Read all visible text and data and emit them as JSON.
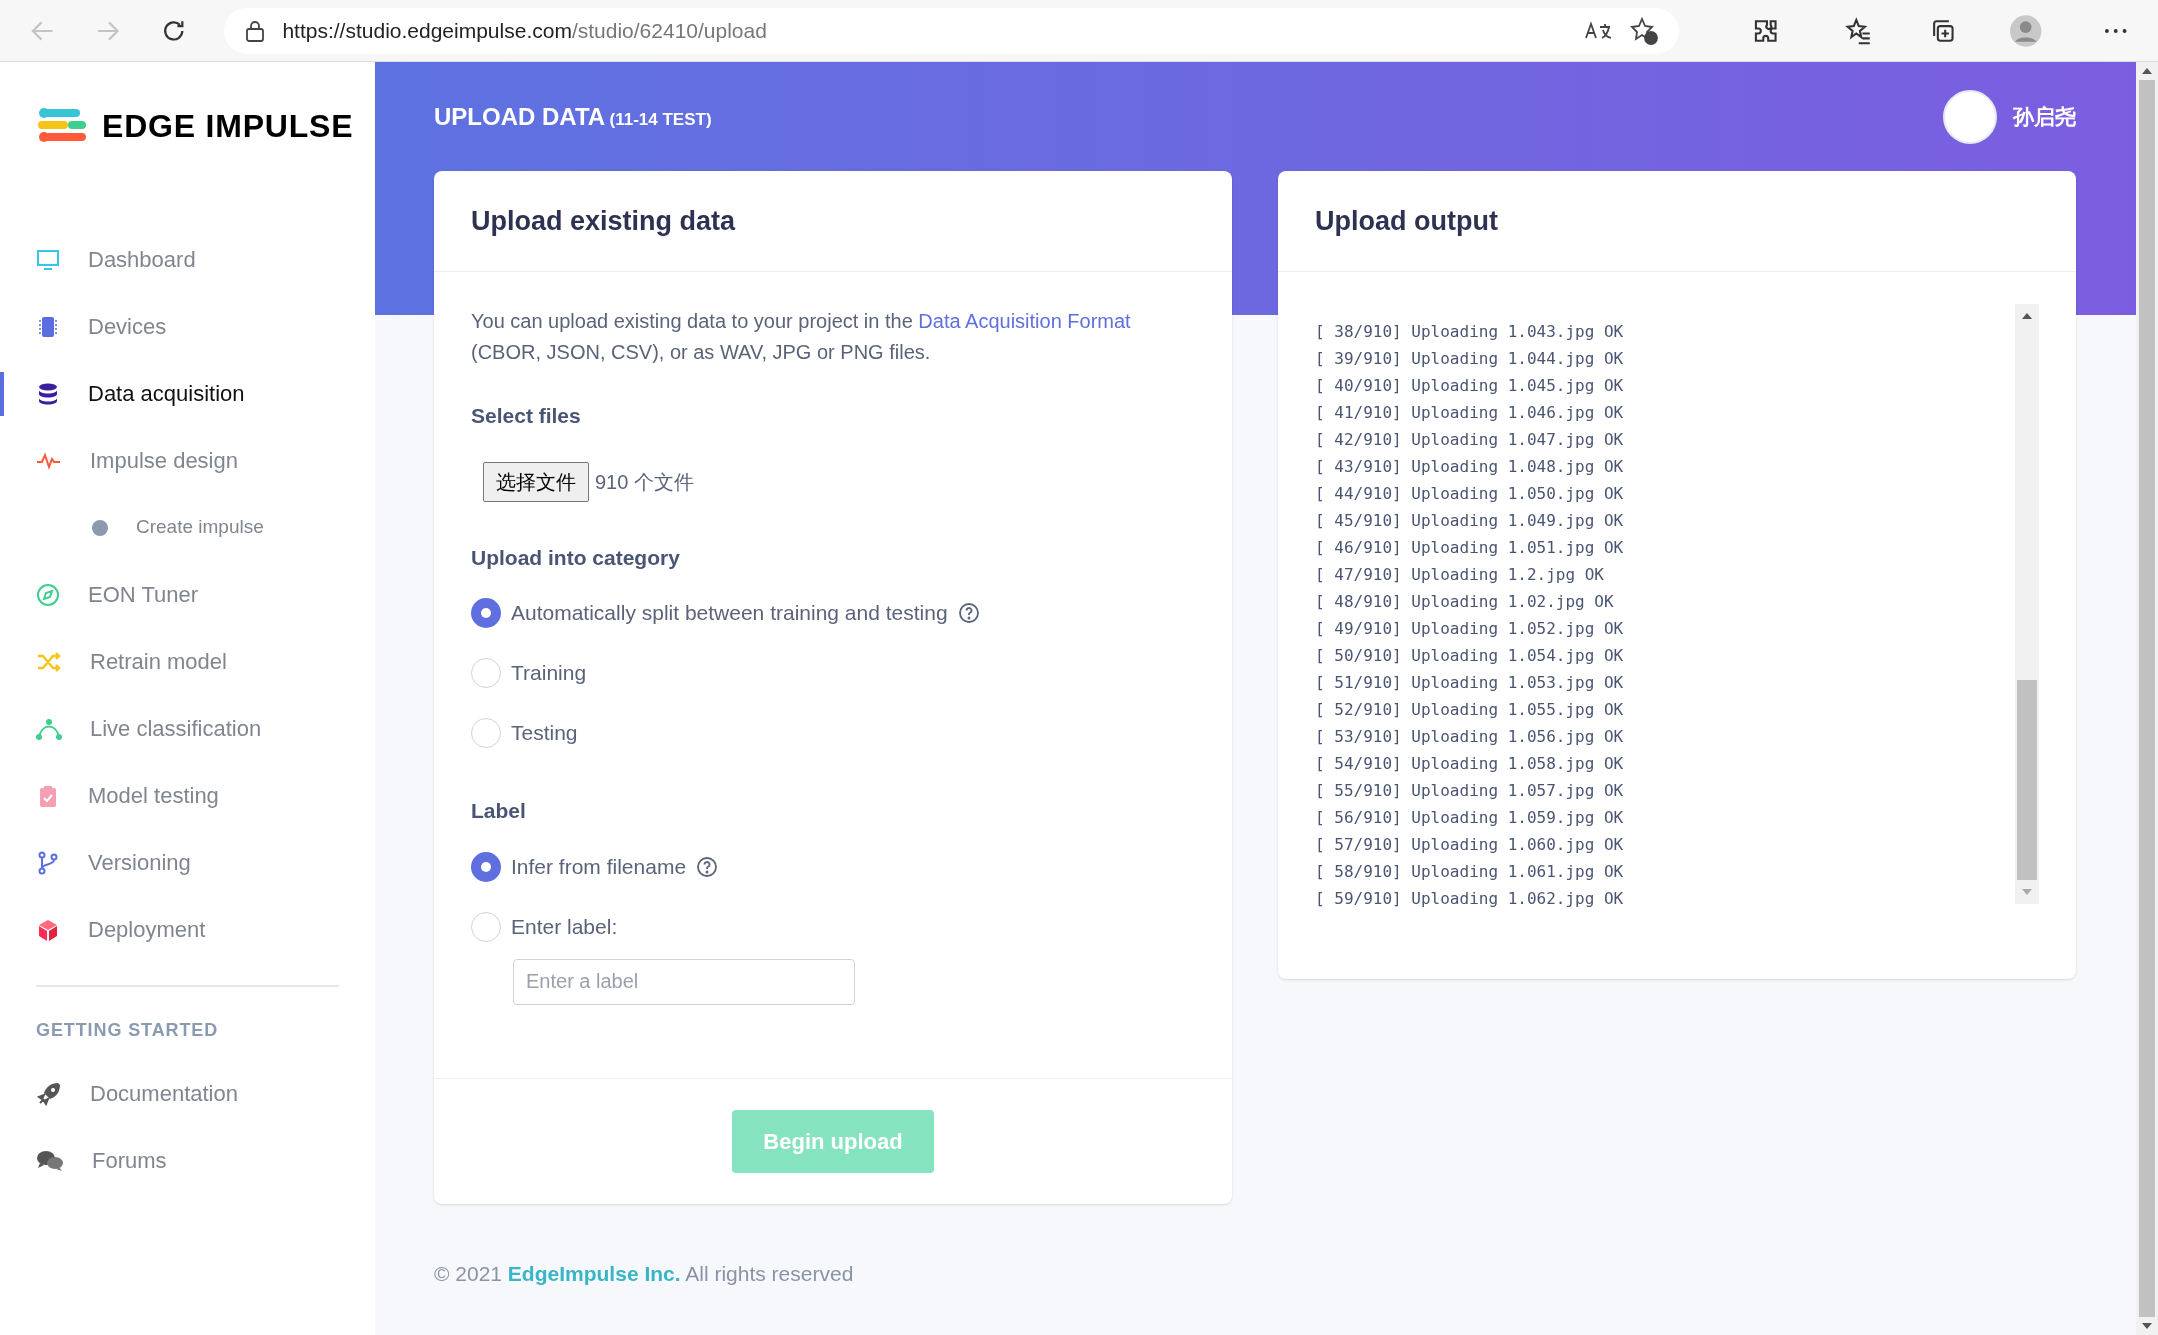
{
  "browser": {
    "url_host": "https://studio.edgeimpulse.com",
    "url_path": "/studio/62410/upload"
  },
  "sidebar": {
    "logo": "EDGE IMPULSE",
    "items": [
      {
        "label": "Dashboard",
        "selected": false
      },
      {
        "label": "Devices",
        "selected": false
      },
      {
        "label": "Data acquisition",
        "selected": true
      },
      {
        "label": "Impulse design",
        "selected": false,
        "children": [
          {
            "label": "Create impulse",
            "selected": false
          }
        ]
      },
      {
        "label": "EON Tuner",
        "selected": false
      },
      {
        "label": "Retrain model",
        "selected": false
      },
      {
        "label": "Live classification",
        "selected": false
      },
      {
        "label": "Model testing",
        "selected": false
      },
      {
        "label": "Versioning",
        "selected": false
      },
      {
        "label": "Deployment",
        "selected": false
      }
    ],
    "section_title": "GETTING STARTED",
    "links": [
      {
        "label": "Documentation"
      },
      {
        "label": "Forums"
      }
    ]
  },
  "header": {
    "title": "UPLOAD DATA",
    "project": "(11-14 TEST)",
    "user": "孙启尧"
  },
  "upload_card": {
    "title": "Upload existing data",
    "description_before": "You can upload existing data to your project in the",
    "description_link": "Data Acquisition Format",
    "description_after": "(CBOR, JSON, CSV), or as WAV, JPG or PNG files.",
    "select_files_label": "Select files",
    "file_button": "选择文件",
    "file_status": "910 个文件",
    "category_label": "Upload into category",
    "category_options": [
      {
        "label": "Automatically split between training and testing",
        "selected": true,
        "help": true
      },
      {
        "label": "Training",
        "selected": false,
        "help": false
      },
      {
        "label": "Testing",
        "selected": false,
        "help": false
      }
    ],
    "label_label": "Label",
    "label_options": [
      {
        "label": "Infer from filename",
        "selected": true,
        "help": true
      },
      {
        "label": "Enter label:",
        "selected": false,
        "help": false
      }
    ],
    "label_placeholder": "Enter a label",
    "submit": {
      "label": "Begin upload",
      "disabled": true
    }
  },
  "output_card": {
    "title": "Upload output",
    "lines": [
      "[ 38/910] Uploading 1.043.jpg OK",
      "[ 39/910] Uploading 1.044.jpg OK",
      "[ 40/910] Uploading 1.045.jpg OK",
      "[ 41/910] Uploading 1.046.jpg OK",
      "[ 42/910] Uploading 1.047.jpg OK",
      "[ 43/910] Uploading 1.048.jpg OK",
      "[ 44/910] Uploading 1.050.jpg OK",
      "[ 45/910] Uploading 1.049.jpg OK",
      "[ 46/910] Uploading 1.051.jpg OK",
      "[ 47/910] Uploading 1.2.jpg OK",
      "[ 48/910] Uploading 1.02.jpg OK",
      "[ 49/910] Uploading 1.052.jpg OK",
      "[ 50/910] Uploading 1.054.jpg OK",
      "[ 51/910] Uploading 1.053.jpg OK",
      "[ 52/910] Uploading 1.055.jpg OK",
      "[ 53/910] Uploading 1.056.jpg OK",
      "[ 54/910] Uploading 1.058.jpg OK",
      "[ 55/910] Uploading 1.057.jpg OK",
      "[ 56/910] Uploading 1.059.jpg OK",
      "[ 57/910] Uploading 1.060.jpg OK",
      "[ 58/910] Uploading 1.061.jpg OK",
      "[ 59/910] Uploading 1.062.jpg OK"
    ]
  },
  "footer": {
    "copyright": "© 2021",
    "company": "EdgeImpulse Inc.",
    "rights": "All rights reserved"
  }
}
